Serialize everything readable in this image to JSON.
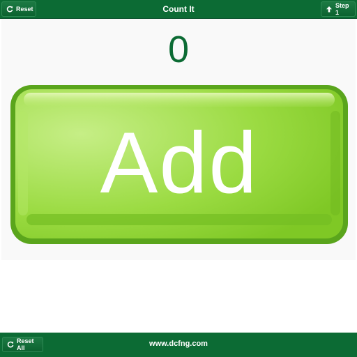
{
  "header": {
    "title": "Count It",
    "reset_label": "Reset",
    "step_label": "Step 1",
    "reset_icon": "refresh-icon",
    "step_icon": "arrow-up-icon"
  },
  "main": {
    "count": "0",
    "add_label": "Add"
  },
  "footer": {
    "reset_all_label": "Reset All",
    "site": "www.dcfng.com",
    "reset_all_icon": "refresh-icon"
  },
  "colors": {
    "brand_green": "#0c6b34",
    "button_green": "#8fd43a",
    "button_border": "#5aa51c"
  }
}
